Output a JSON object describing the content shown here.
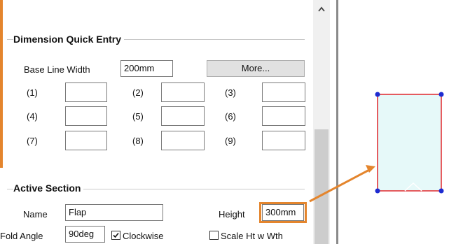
{
  "dimension_quick_entry": {
    "title": "Dimension Quick Entry",
    "base_line_width_label": "Base Line Width",
    "base_line_width_value": "200mm",
    "more_button": "More...",
    "fields": [
      {
        "label": "(1)",
        "value": ""
      },
      {
        "label": "(2)",
        "value": ""
      },
      {
        "label": "(3)",
        "value": ""
      },
      {
        "label": "(4)",
        "value": ""
      },
      {
        "label": "(5)",
        "value": ""
      },
      {
        "label": "(6)",
        "value": ""
      },
      {
        "label": "(7)",
        "value": ""
      },
      {
        "label": "(8)",
        "value": ""
      },
      {
        "label": "(9)",
        "value": ""
      }
    ]
  },
  "active_section": {
    "title": "Active Section",
    "name_label": "Name",
    "name_value": "Flap",
    "height_label": "Height",
    "height_value": "300mm",
    "fold_angle_label": "Fold Angle",
    "fold_angle_value": "90deg",
    "clockwise_label": "Clockwise",
    "clockwise_checked": true,
    "scale_label": "Scale Ht w Wth",
    "scale_checked": false
  },
  "colors": {
    "accent_orange": "#e4852d",
    "shape_fill": "#e6f9f9",
    "shape_stroke": "#e0262b",
    "handle": "#1d2bd1"
  },
  "icons": {
    "scroll_up": "chevron-up-icon"
  }
}
